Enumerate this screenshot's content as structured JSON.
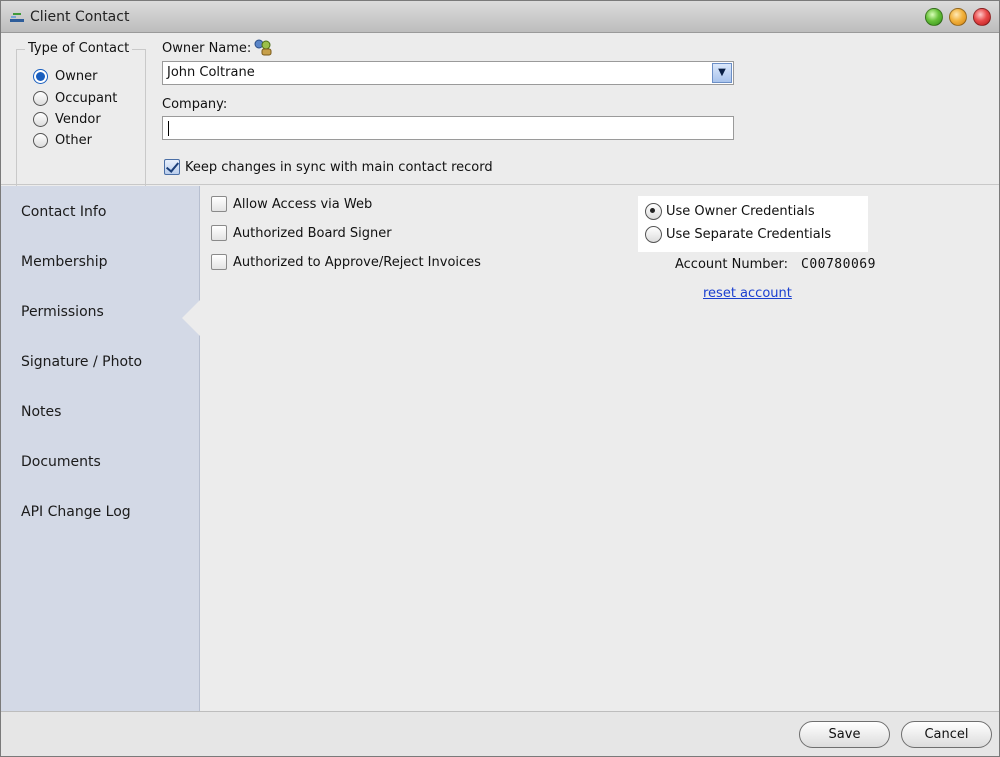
{
  "window": {
    "title": "Client Contact",
    "controls": [
      "minimize",
      "maximize",
      "close"
    ]
  },
  "type_of_contact": {
    "legend": "Type of Contact",
    "options": [
      {
        "label": "Owner",
        "selected": true
      },
      {
        "label": "Occupant",
        "selected": false
      },
      {
        "label": "Vendor",
        "selected": false
      },
      {
        "label": "Other",
        "selected": false
      }
    ]
  },
  "owner": {
    "label": "Owner Name:",
    "value": "John Coltrane",
    "lookup_icon": "people-search-icon"
  },
  "company": {
    "label": "Company:",
    "value": ""
  },
  "sync": {
    "label": "Keep changes in sync with main contact record",
    "checked": true
  },
  "sidebar": {
    "items": [
      {
        "label": "Contact Info"
      },
      {
        "label": "Membership"
      },
      {
        "label": "Permissions",
        "active": true
      },
      {
        "label": "Signature / Photo"
      },
      {
        "label": "Notes"
      },
      {
        "label": "Documents"
      },
      {
        "label": "API Change Log"
      }
    ]
  },
  "permissions": {
    "checkboxes": [
      {
        "label": "Allow Access via Web",
        "checked": false
      },
      {
        "label": "Authorized Board Signer",
        "checked": false
      },
      {
        "label": "Authorized to Approve/Reject Invoices",
        "checked": false
      }
    ],
    "credentials": [
      {
        "label": "Use Owner Credentials",
        "selected": true
      },
      {
        "label": "Use Separate Credentials",
        "selected": false
      }
    ],
    "account_number_label": "Account Number:",
    "account_number": "C00780069",
    "reset_link": "reset account"
  },
  "footer": {
    "save_label": "Save",
    "cancel_label": "Cancel"
  },
  "colors": {
    "sidebar_bg": "#d3d9e6",
    "accent_blue": "#1a5fbf",
    "link": "#1a3fd0"
  }
}
